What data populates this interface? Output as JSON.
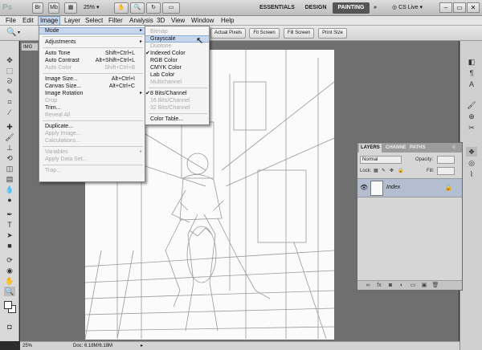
{
  "app": {
    "logo": "Ps",
    "zoom": "25%",
    "workspaces": [
      "ESSENTIALS",
      "DESIGN",
      "PAINTING"
    ],
    "cs_live": "CS Live"
  },
  "menubar": [
    "File",
    "Edit",
    "Image",
    "Layer",
    "Select",
    "Filter",
    "Analysis",
    "3D",
    "View",
    "Window",
    "Help"
  ],
  "options": [
    "Actual Pixels",
    "Fit Screen",
    "Fill Screen",
    "Print Size"
  ],
  "document": {
    "tab": "IMG",
    "status_zoom": "25%",
    "status_doc": "Doc: 6.18M/6.18M"
  },
  "image_menu": [
    {
      "label": "Mode",
      "submenu": true,
      "highlight": true
    },
    {
      "sep": true
    },
    {
      "label": "Adjustments",
      "submenu": true
    },
    {
      "sep": true
    },
    {
      "label": "Auto Tone",
      "shortcut": "Shift+Ctrl+L"
    },
    {
      "label": "Auto Contrast",
      "shortcut": "Alt+Shift+Ctrl+L"
    },
    {
      "label": "Auto Color",
      "shortcut": "Shift+Ctrl+B",
      "disabled": true
    },
    {
      "sep": true
    },
    {
      "label": "Image Size...",
      "shortcut": "Alt+Ctrl+I"
    },
    {
      "label": "Canvas Size...",
      "shortcut": "Alt+Ctrl+C"
    },
    {
      "label": "Image Rotation",
      "submenu": true
    },
    {
      "label": "Crop",
      "disabled": true
    },
    {
      "label": "Trim..."
    },
    {
      "label": "Reveal All",
      "disabled": true
    },
    {
      "sep": true
    },
    {
      "label": "Duplicate..."
    },
    {
      "label": "Apply Image...",
      "disabled": true
    },
    {
      "label": "Calculations...",
      "disabled": true
    },
    {
      "sep": true
    },
    {
      "label": "Variables",
      "submenu": true,
      "disabled": true
    },
    {
      "label": "Apply Data Set...",
      "disabled": true
    },
    {
      "sep": true
    },
    {
      "label": "Trap...",
      "disabled": true
    }
  ],
  "mode_menu": [
    {
      "label": "Bitmap",
      "disabled": true
    },
    {
      "label": "Grayscale",
      "highlight": true
    },
    {
      "label": "Duotone",
      "disabled": true
    },
    {
      "label": "Indexed Color",
      "checked": true
    },
    {
      "label": "RGB Color"
    },
    {
      "label": "CMYK Color"
    },
    {
      "label": "Lab Color"
    },
    {
      "label": "Multichannel",
      "disabled": true
    },
    {
      "sep": true
    },
    {
      "label": "8 Bits/Channel",
      "checked": true
    },
    {
      "label": "16 Bits/Channel",
      "disabled": true
    },
    {
      "label": "32 Bits/Channel",
      "disabled": true
    },
    {
      "sep": true
    },
    {
      "label": "Color Table..."
    }
  ],
  "layers_panel": {
    "tabs": [
      "LAYERS",
      "CHANNE",
      "PATHS"
    ],
    "blend_mode": "Normal",
    "opacity_label": "Opacity:",
    "lock_label": "Lock:",
    "fill_label": "Fill:",
    "layer_name": "Index"
  }
}
